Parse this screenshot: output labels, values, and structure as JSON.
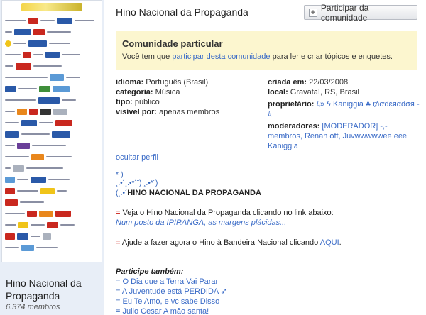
{
  "sidebar": {
    "community_name": "Hino Nacional da Propaganda",
    "members": "6.374 membros"
  },
  "header": {
    "title": "Hino Nacional da Propaganda",
    "join_button": "Participar da comunidade"
  },
  "notice": {
    "title": "Comunidade particular",
    "text_before": "Você tem que ",
    "link": "participar desta comunidade",
    "text_after": " para ler e criar tópicos e enquetes."
  },
  "profile": {
    "idioma_label": "idioma:",
    "idioma": "Português (Brasil)",
    "categoria_label": "categoria:",
    "categoria": "Música",
    "tipo_label": "tipo:",
    "tipo": "público",
    "visivel_label": "visível por:",
    "visivel": "apenas membros",
    "criada_label": "criada em:",
    "criada": "22/03/2008",
    "local_label": "local:",
    "local": "Gravataí, RS, Brasil",
    "proprietario_label": "proprietário:",
    "proprietario": "ﾑ» ϟ Kaniggia ♣ ₥ơɗɛяαɗσя - ﾑ",
    "moderadores_label": "moderadores:",
    "moderadores": "[MODERADOR] -,- membros, Renan off, Juvwwwwwee eee | Kaniggia",
    "hide_profile": "ocultar perfil"
  },
  "about": {
    "deco1": "*¨)",
    "deco2": "¸.•´¸.•*´¨) ¸.•*¨)",
    "deco3": "(¸.•´",
    "hino_title": "HINO NACIONAL DA PROPAGANDA",
    "p1_eq": "=",
    "p1": " Veja o Hino Nacional da Propaganda clicando no link abaixo:",
    "p1_link": "Num posto da IPIRANGA, as margens plácidas...",
    "p2_eq": "=",
    "p2": " Ajude a fazer agora o Hino à Bandeira Nacional clicando ",
    "p2_link": "AQUI",
    "p2_end": ".",
    "also_title": "Participe também:",
    "also": [
      {
        "eq": "=",
        "label": "O Dia que a Terra Vai Parar"
      },
      {
        "eq": "=",
        "label": "A Juventude está PERDIDA ➶"
      },
      {
        "eq": "=",
        "label": "Eu Te Amo, e vc sabe Disso"
      },
      {
        "eq": "=",
        "label": "Julio Cesar A mão santa!"
      }
    ]
  },
  "colors": {
    "link": "#3a6bc7",
    "notice_bg": "#fcf6cf",
    "sidebar_bg": "#e8eef7"
  }
}
